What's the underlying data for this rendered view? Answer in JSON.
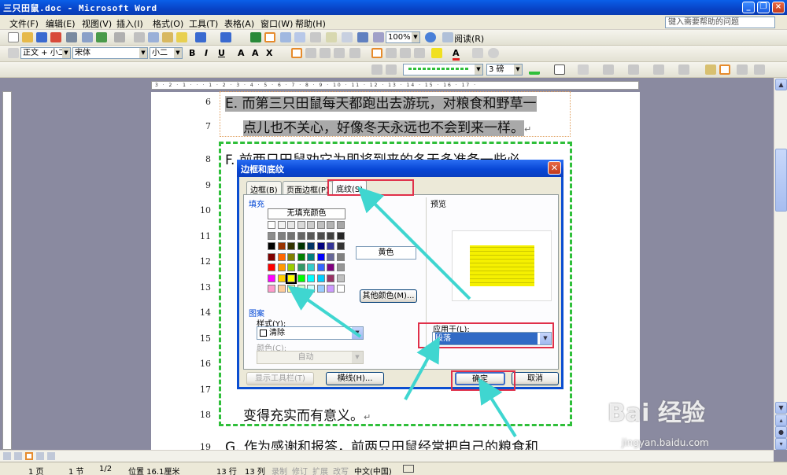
{
  "window": {
    "title": "三只田鼠.doc - Microsoft Word"
  },
  "menu": [
    "文件(F)",
    "编辑(E)",
    "视图(V)",
    "插入(I)",
    "格式(O)",
    "工具(T)",
    "表格(A)",
    "窗口(W)",
    "帮助(H)"
  ],
  "help_box": "键入需要帮助的问题",
  "toolbar": {
    "zoom": "100%",
    "read": "阅读(R)",
    "style": "正文 + 小二",
    "font": "宋体",
    "size": "小二",
    "line_weight": "3 磅"
  },
  "ruler_marks": "3 · 2 · 1 · · · 1 · 2 · 3 · 4 · 5 · 6 · 7 · 8 · 9 · 10 · 11 · 12 · 13 · 14 · 15 · 16 · 17 ·",
  "document": {
    "line_numbers": [
      "6",
      "7",
      "8",
      "9",
      "10",
      "11",
      "12",
      "13",
      "14",
      "15",
      "16",
      "17",
      "18",
      "19"
    ],
    "lines": {
      "l6": "E. 而第三只田鼠每天都跑出去游玩，对粮食和野草一",
      "l7": "点儿也不关心，好像冬天永远也不会到来一样。",
      "l8": "F. 前两只田鼠劝它为即将到来的冬天多准备一些必",
      "l18": "变得充实而有意义。",
      "l19": "G. 作为感谢和报答，前两只田鼠经常把自己的粮食和"
    },
    "pilcrow": "↵"
  },
  "dialog": {
    "title": "边框和底纹",
    "tabs": [
      "边框(B)",
      "页面边框(P)",
      "底纹(S)"
    ],
    "fill_group": "填充",
    "no_fill": "无填充颜色",
    "color_name": "黄色",
    "more_colors": "其他颜色(M)...",
    "pattern_group": "图案",
    "style_label": "样式(Y):",
    "style_value": "清除",
    "color_label": "颜色(C):",
    "color_value": "自动",
    "preview_label": "预览",
    "apply_label": "应用于(L):",
    "apply_value": "段落",
    "show_toolbar": "显示工具栏(T)",
    "horizontal_line": "横线(H)...",
    "ok": "确定",
    "cancel": "取消",
    "palette": [
      [
        "#000000",
        "#993300",
        "#333300",
        "#003300",
        "#003366",
        "#000080",
        "#333399",
        "#333333"
      ],
      [
        "#800000",
        "#FF6600",
        "#808000",
        "#008000",
        "#008080",
        "#0000FF",
        "#666699",
        "#808080"
      ],
      [
        "#FF0000",
        "#FF9900",
        "#99CC00",
        "#339966",
        "#33CCCC",
        "#3366FF",
        "#800080",
        "#969696"
      ],
      [
        "#FF00FF",
        "#FFCC00",
        "#FFFF00",
        "#00FF00",
        "#00FFFF",
        "#00CCFF",
        "#993366",
        "#C0C0C0"
      ],
      [
        "#FF99CC",
        "#FFCC99",
        "#FFFF99",
        "#CCFFCC",
        "#CCFFFF",
        "#99CCFF",
        "#CC99FF",
        "#FFFFFF"
      ]
    ],
    "palette_top": [
      "#FFFFFF",
      "#F2F2F2",
      "#E6E6E6",
      "#D9D9D9",
      "#CCCCCC",
      "#BFBFBF",
      "#B3B3B3",
      "#A6A6A6"
    ],
    "palette_grays": [
      "#8C8C8C",
      "#808080",
      "#737373",
      "#666666",
      "#595959",
      "#4D4D4D",
      "#404040",
      "#262626"
    ],
    "selected_color": "#FFFF00"
  },
  "status": {
    "page": "1 页",
    "section": "1 节",
    "pages": "1/2",
    "position": "位置 16.1厘米",
    "line": "13 行",
    "col": "13 列",
    "rec": "录制",
    "trk": "修订",
    "ext": "扩展",
    "ovr": "改写",
    "lang": "中文(中国)"
  },
  "watermark": {
    "brand": "Bai  经验",
    "url": "jingyan.baidu.com"
  }
}
